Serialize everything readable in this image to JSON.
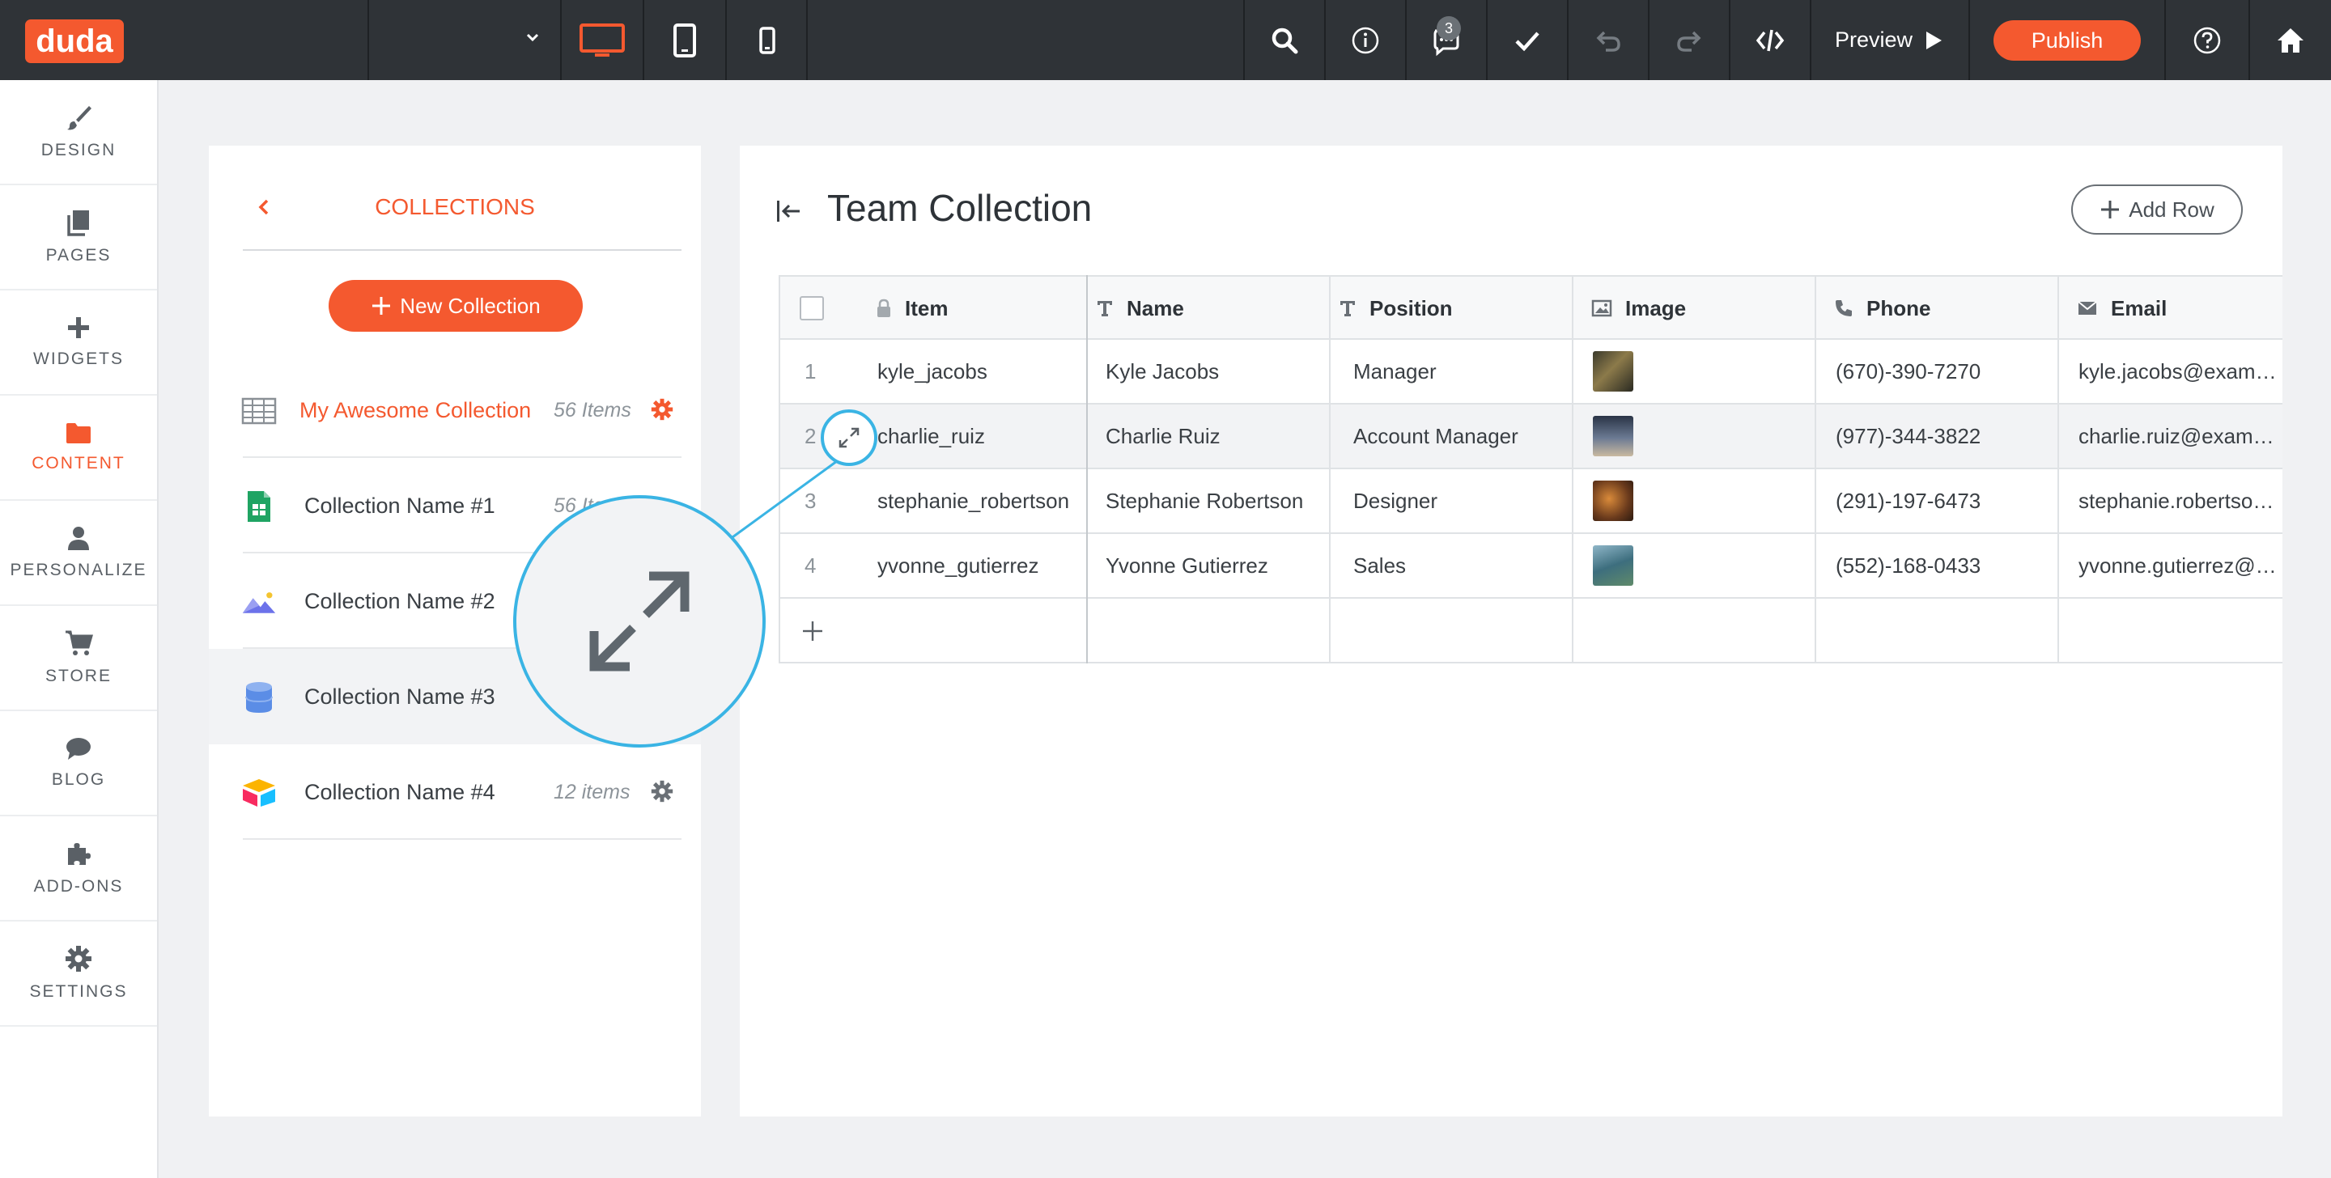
{
  "app": {
    "logo_text": "duda",
    "brand_color": "#f4592f",
    "page_select_value": "",
    "comments_count": "3",
    "preview_label": "Preview",
    "publish_label": "Publish"
  },
  "leftnav": {
    "items": [
      {
        "label": "DESIGN",
        "icon": "brush-icon"
      },
      {
        "label": "PAGES",
        "icon": "pages-icon"
      },
      {
        "label": "WIDGETS",
        "icon": "plus-icon"
      },
      {
        "label": "CONTENT",
        "icon": "folder-icon",
        "active": true
      },
      {
        "label": "PERSONALIZE",
        "icon": "person-icon"
      },
      {
        "label": "STORE",
        "icon": "cart-icon"
      },
      {
        "label": "BLOG",
        "icon": "speech-bubble-icon"
      },
      {
        "label": "ADD-ONS",
        "icon": "puzzle-icon"
      },
      {
        "label": "SETTINGS",
        "icon": "gear-icon"
      }
    ]
  },
  "collections": {
    "title": "COLLECTIONS",
    "new_button": "New Collection",
    "items": [
      {
        "name": "My Awesome Collection",
        "count": "56 Items",
        "icon": "table-icon"
      },
      {
        "name": "Collection Name #1",
        "count": "56 Items",
        "icon": "google-sheets-icon"
      },
      {
        "name": "Collection Name #2",
        "count": "",
        "icon": "image-gallery-icon"
      },
      {
        "name": "Collection Name #3",
        "count": "",
        "icon": "database-icon"
      },
      {
        "name": "Collection Name #4",
        "count": "12 items",
        "icon": "airtable-icon"
      }
    ]
  },
  "main": {
    "title": "Team Collection",
    "add_row": "Add Row",
    "columns": [
      {
        "label": "Item",
        "icon": "lock-icon"
      },
      {
        "label": "Name",
        "icon": "text-type-icon"
      },
      {
        "label": "Position",
        "icon": "text-type-icon"
      },
      {
        "label": "Image",
        "icon": "image-icon"
      },
      {
        "label": "Phone",
        "icon": "phone-icon"
      },
      {
        "label": "Email",
        "icon": "envelope-icon"
      }
    ],
    "rows": [
      {
        "num": "1",
        "item": "kyle_jacobs",
        "name": "Kyle Jacobs",
        "position": "Manager",
        "phone": "(670)-390-7270",
        "email": "kyle.jacobs@exam…"
      },
      {
        "num": "2",
        "item": "charlie_ruiz",
        "name": "Charlie Ruiz",
        "position": "Account Manager",
        "phone": "(977)-344-3822",
        "email": "charlie.ruiz@exam…"
      },
      {
        "num": "3",
        "item": "stephanie_robertson",
        "name": "Stephanie Robertson",
        "position": "Designer",
        "phone": "(291)-197-6473",
        "email": "stephanie.robertso…"
      },
      {
        "num": "4",
        "item": "yvonne_gutierrez",
        "name": "Yvonne Gutierrez",
        "position": "Sales",
        "phone": "(552)-168-0433",
        "email": "yvonne.gutierrez@…"
      }
    ]
  },
  "callout": {
    "accent_color": "#3ab4e4",
    "icon": "expand-icon"
  }
}
